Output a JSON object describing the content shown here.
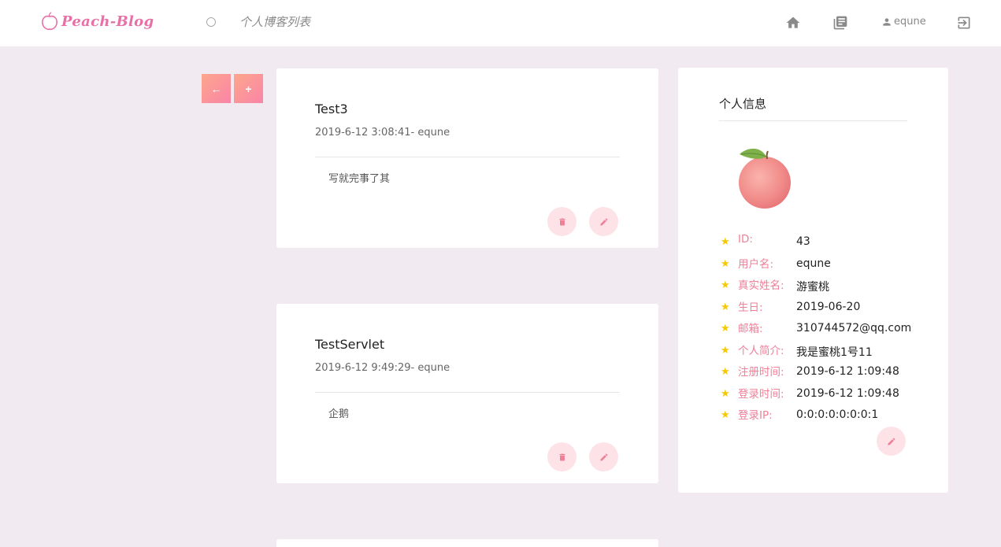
{
  "header": {
    "logo_text": "Peach-Blog",
    "page_title": "个人博客列表",
    "username": "equne"
  },
  "side_buttons": {
    "back": "←",
    "add": "+"
  },
  "posts": [
    {
      "title": "Test3",
      "meta": "2019-6-12 3:08:41- equne",
      "body": "写就完事了其"
    },
    {
      "title": "TestServlet",
      "meta": "2019-6-12 9:49:29- equne",
      "body": "企鹅"
    }
  ],
  "profile": {
    "heading": "个人信息",
    "fields": [
      {
        "label": "ID:",
        "value": "43"
      },
      {
        "label": "用户名:",
        "value": "equne"
      },
      {
        "label": "真实姓名:",
        "value": "游蜜桃"
      },
      {
        "label": "生日:",
        "value": "2019-06-20"
      },
      {
        "label": "邮箱:",
        "value": "310744572@qq.com"
      },
      {
        "label": "个人简介:",
        "value": "我是蜜桃1号11"
      },
      {
        "label": "注册时间:",
        "value": "2019-6-12 1:09:48"
      },
      {
        "label": "登录时间:",
        "value": "2019-6-12 1:09:48"
      },
      {
        "label": "登录IP:",
        "value": "0:0:0:0:0:0:0:1"
      }
    ]
  },
  "colors": {
    "accent": "#f07f98",
    "logo": "#e771a7",
    "background": "#f1ebf1",
    "button_bg": "#fde3e8",
    "star": "#f6c800"
  }
}
